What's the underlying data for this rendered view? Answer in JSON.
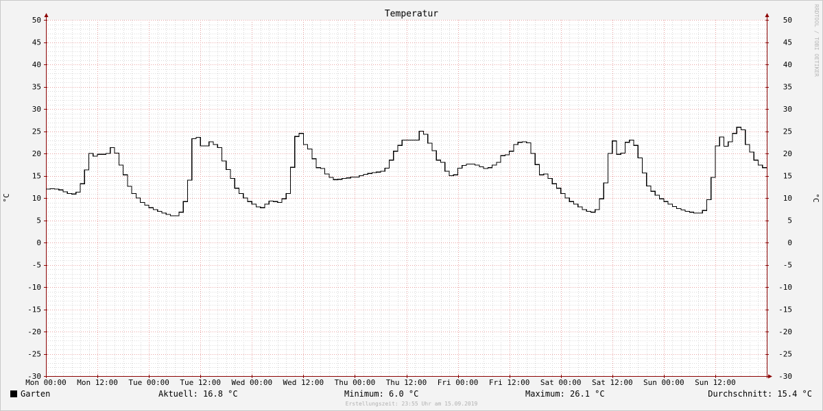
{
  "chart_data": {
    "type": "line",
    "title": "Temperatur",
    "ylabel": "°C",
    "ylim": [
      -30,
      50
    ],
    "yticks": [
      50,
      45,
      40,
      35,
      30,
      25,
      20,
      15,
      10,
      5,
      0,
      -5,
      -10,
      -15,
      -20,
      -25,
      -30
    ],
    "xlim": [
      0,
      168
    ],
    "xticks": [
      {
        "x": 0,
        "label": "Mon 00:00"
      },
      {
        "x": 12,
        "label": "Mon 12:00"
      },
      {
        "x": 24,
        "label": "Tue 00:00"
      },
      {
        "x": 36,
        "label": "Tue 12:00"
      },
      {
        "x": 48,
        "label": "Wed 00:00"
      },
      {
        "x": 60,
        "label": "Wed 12:00"
      },
      {
        "x": 72,
        "label": "Thu 00:00"
      },
      {
        "x": 84,
        "label": "Thu 12:00"
      },
      {
        "x": 96,
        "label": "Fri 00:00"
      },
      {
        "x": 108,
        "label": "Fri 12:00"
      },
      {
        "x": 120,
        "label": "Sat 00:00"
      },
      {
        "x": 132,
        "label": "Sat 12:00"
      },
      {
        "x": 144,
        "label": "Sun 00:00"
      },
      {
        "x": 156,
        "label": "Sun 12:00"
      }
    ],
    "series": [
      {
        "name": "Garten",
        "color": "#000000",
        "step": true,
        "points": [
          [
            0,
            12.0
          ],
          [
            1,
            12.1
          ],
          [
            2,
            12.0
          ],
          [
            3,
            11.8
          ],
          [
            4,
            11.4
          ],
          [
            5,
            11.0
          ],
          [
            6,
            10.9
          ],
          [
            7,
            11.3
          ],
          [
            8,
            13.2
          ],
          [
            9,
            16.3
          ],
          [
            10,
            20.0
          ],
          [
            11,
            19.4
          ],
          [
            12,
            19.8
          ],
          [
            13,
            19.8
          ],
          [
            14,
            20.0
          ],
          [
            15,
            21.3
          ],
          [
            16,
            20.1
          ],
          [
            17,
            17.4
          ],
          [
            18,
            15.2
          ],
          [
            19,
            12.6
          ],
          [
            20,
            11.0
          ],
          [
            21,
            10.0
          ],
          [
            22,
            9.0
          ],
          [
            23,
            8.4
          ],
          [
            24,
            7.8
          ],
          [
            25,
            7.4
          ],
          [
            26,
            7.0
          ],
          [
            27,
            6.6
          ],
          [
            28,
            6.3
          ],
          [
            29,
            6.0
          ],
          [
            30,
            6.0
          ],
          [
            31,
            6.8
          ],
          [
            32,
            9.2
          ],
          [
            33,
            14.0
          ],
          [
            34,
            23.3
          ],
          [
            35,
            23.6
          ],
          [
            36,
            21.7
          ],
          [
            37,
            21.7
          ],
          [
            38,
            22.6
          ],
          [
            39,
            22.0
          ],
          [
            40,
            21.3
          ],
          [
            41,
            18.3
          ],
          [
            42,
            16.4
          ],
          [
            43,
            14.4
          ],
          [
            44,
            12.2
          ],
          [
            45,
            11.0
          ],
          [
            46,
            10.0
          ],
          [
            47,
            9.2
          ],
          [
            48,
            8.6
          ],
          [
            49,
            8.0
          ],
          [
            50,
            7.8
          ],
          [
            51,
            8.6
          ],
          [
            52,
            9.3
          ],
          [
            53,
            9.2
          ],
          [
            54,
            9.0
          ],
          [
            55,
            9.8
          ],
          [
            56,
            11.0
          ],
          [
            57,
            16.9
          ],
          [
            58,
            23.8
          ],
          [
            59,
            24.5
          ],
          [
            60,
            22.0
          ],
          [
            61,
            21.0
          ],
          [
            62,
            18.8
          ],
          [
            63,
            16.8
          ],
          [
            64,
            16.6
          ],
          [
            65,
            15.4
          ],
          [
            66,
            14.6
          ],
          [
            67,
            14.1
          ],
          [
            68,
            14.2
          ],
          [
            69,
            14.4
          ],
          [
            70,
            14.5
          ],
          [
            71,
            14.7
          ],
          [
            72,
            14.7
          ],
          [
            73,
            15.0
          ],
          [
            74,
            15.3
          ],
          [
            75,
            15.5
          ],
          [
            76,
            15.7
          ],
          [
            77,
            15.8
          ],
          [
            78,
            16.0
          ],
          [
            79,
            16.7
          ],
          [
            80,
            18.5
          ],
          [
            81,
            20.5
          ],
          [
            82,
            21.8
          ],
          [
            83,
            23.0
          ],
          [
            84,
            23.0
          ],
          [
            85,
            23.0
          ],
          [
            86,
            23.0
          ],
          [
            87,
            25.0
          ],
          [
            88,
            24.3
          ],
          [
            89,
            22.3
          ],
          [
            90,
            20.6
          ],
          [
            91,
            18.5
          ],
          [
            92,
            18.0
          ],
          [
            93,
            16.0
          ],
          [
            94,
            15.0
          ],
          [
            95,
            15.2
          ],
          [
            96,
            16.7
          ],
          [
            97,
            17.3
          ],
          [
            98,
            17.6
          ],
          [
            99,
            17.6
          ],
          [
            100,
            17.4
          ],
          [
            101,
            17.0
          ],
          [
            102,
            16.6
          ],
          [
            103,
            16.8
          ],
          [
            104,
            17.4
          ],
          [
            105,
            18.0
          ],
          [
            106,
            19.5
          ],
          [
            107,
            19.7
          ],
          [
            108,
            20.5
          ],
          [
            109,
            22.0
          ],
          [
            110,
            22.5
          ],
          [
            111,
            22.6
          ],
          [
            112,
            22.4
          ],
          [
            113,
            20.0
          ],
          [
            114,
            17.5
          ],
          [
            115,
            15.2
          ],
          [
            116,
            15.4
          ],
          [
            117,
            14.4
          ],
          [
            118,
            13.2
          ],
          [
            119,
            12.2
          ],
          [
            120,
            11.0
          ],
          [
            121,
            10.0
          ],
          [
            122,
            9.2
          ],
          [
            123,
            8.6
          ],
          [
            124,
            8.0
          ],
          [
            125,
            7.4
          ],
          [
            126,
            7.0
          ],
          [
            127,
            6.8
          ],
          [
            128,
            7.4
          ],
          [
            129,
            9.8
          ],
          [
            130,
            13.4
          ],
          [
            131,
            20.0
          ],
          [
            132,
            22.8
          ],
          [
            133,
            19.8
          ],
          [
            134,
            20.1
          ],
          [
            135,
            22.5
          ],
          [
            136,
            23.0
          ],
          [
            137,
            21.8
          ],
          [
            138,
            19.0
          ],
          [
            139,
            15.6
          ],
          [
            140,
            12.7
          ],
          [
            141,
            11.5
          ],
          [
            142,
            10.6
          ],
          [
            143,
            9.8
          ],
          [
            144,
            9.2
          ],
          [
            145,
            8.6
          ],
          [
            146,
            8.1
          ],
          [
            147,
            7.6
          ],
          [
            148,
            7.3
          ],
          [
            149,
            7.0
          ],
          [
            150,
            6.8
          ],
          [
            151,
            6.6
          ],
          [
            152,
            6.6
          ],
          [
            153,
            7.2
          ],
          [
            154,
            9.6
          ],
          [
            155,
            14.6
          ],
          [
            156,
            21.7
          ],
          [
            157,
            23.7
          ],
          [
            158,
            21.6
          ],
          [
            159,
            22.6
          ],
          [
            160,
            24.5
          ],
          [
            161,
            25.9
          ],
          [
            162,
            25.3
          ],
          [
            163,
            22.0
          ],
          [
            164,
            20.3
          ],
          [
            165,
            18.5
          ],
          [
            166,
            17.4
          ],
          [
            167,
            16.8
          ],
          [
            168,
            16.8
          ]
        ]
      }
    ]
  },
  "legend": {
    "series_label": "Garten",
    "current": "Aktuell: 16.8 °C",
    "minimum": "Minimum: 6.0 °C",
    "maximum": "Maximum: 26.1 °C",
    "average": "Durchschnitt: 15.4 °C"
  },
  "footer": "Erstellungszeit: 23:55 Uhr am 15.09.2019",
  "watermark": "RRDTOOL / TOBI OETIKER",
  "colors": {
    "background": "#f3f3f3",
    "plot_background": "#ffffff",
    "major_grid": "#e8a0a0",
    "minor_grid": "#d8d8d8",
    "axis": "#8b0000",
    "line": "#000000"
  }
}
